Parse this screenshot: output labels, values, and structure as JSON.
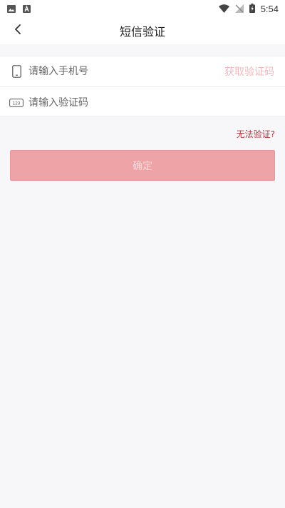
{
  "status_bar": {
    "time": "5:54",
    "icons": [
      "image-notification-icon",
      "a-notification-icon",
      "wifi-icon",
      "no-signal-icon",
      "battery-charging-icon"
    ]
  },
  "header": {
    "title": "短信验证",
    "back_icon": "chevron-left-icon"
  },
  "form": {
    "phone": {
      "placeholder": "请输入手机号",
      "value": "",
      "icon": "phone-icon"
    },
    "get_code_label": "获取验证码",
    "code": {
      "placeholder": "请输入验证码",
      "value": "",
      "icon": "code-123-icon",
      "icon_text": "123"
    }
  },
  "cant_verify_label": "无法验证?",
  "confirm_label": "确定",
  "colors": {
    "accent_light": "#eea3a7",
    "get_code_text": "#f2b8bd",
    "link_red": "#b0343a",
    "background": "#f7f7fa"
  }
}
